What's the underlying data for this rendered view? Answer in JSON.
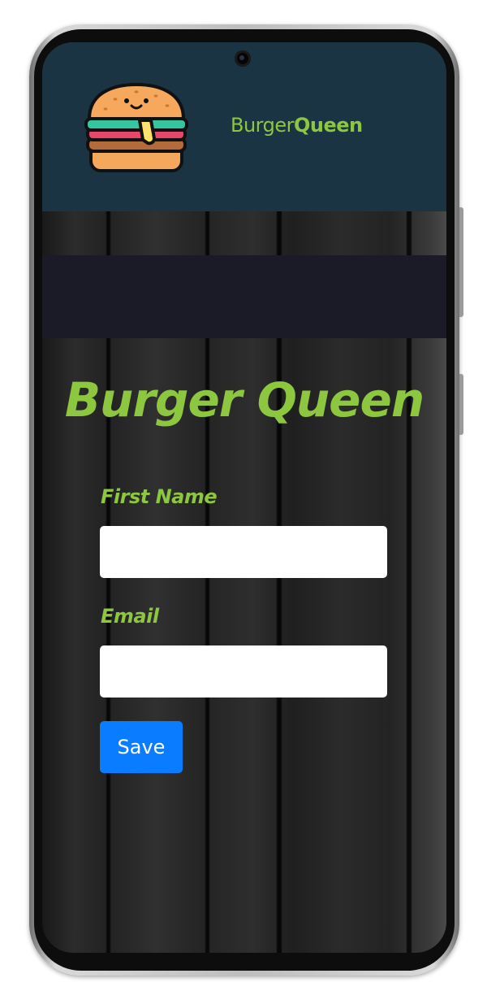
{
  "header": {
    "logo_icon": "burger-logo-icon",
    "brand_regular": "Burger",
    "brand_bold": "Queen"
  },
  "main": {
    "title": "Burger Queen",
    "form": {
      "first_name_label": "First Name",
      "first_name_value": "",
      "email_label": "Email",
      "email_value": "",
      "save_label": "Save"
    }
  },
  "colors": {
    "header_bg": "#1b3444",
    "accent_green": "#8dc63f",
    "banner_bg": "#1b1b27",
    "button_blue": "#0a7cff"
  }
}
